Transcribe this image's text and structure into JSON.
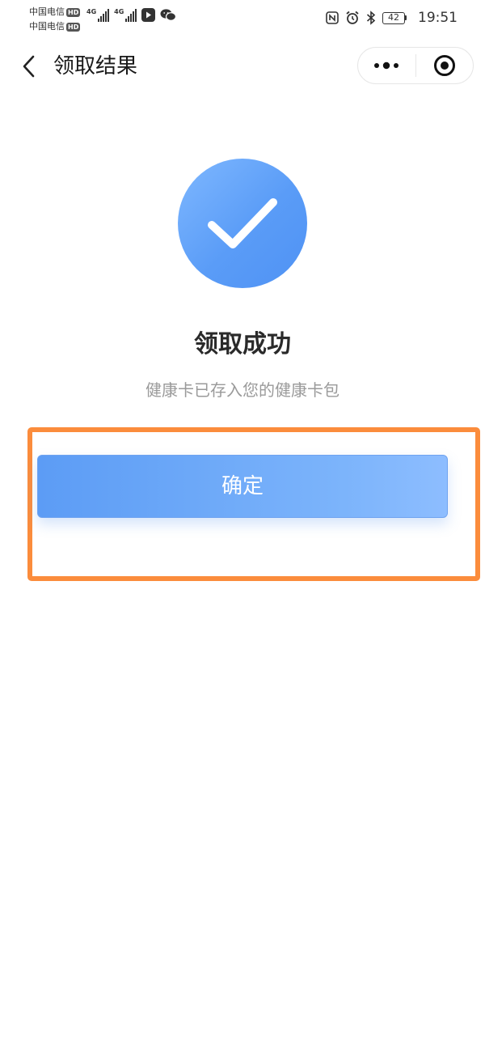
{
  "status_bar": {
    "carriers": [
      {
        "name": "中国电信",
        "badge": "HD"
      },
      {
        "name": "中国电信",
        "badge": "HD"
      }
    ],
    "network": [
      "4G",
      "4G"
    ],
    "battery_level": "42",
    "time": "19:51",
    "icons": [
      "nfc-icon",
      "alarm-icon",
      "bluetooth-icon",
      "battery-icon"
    ]
  },
  "nav": {
    "back_icon": "chevron-left-icon",
    "title": "领取结果",
    "menu_icon": "more-dots-icon",
    "close_icon": "target-close-icon"
  },
  "result": {
    "icon": "checkmark-icon",
    "title": "领取成功",
    "subtitle": "健康卡已存入您的健康卡包"
  },
  "actions": {
    "confirm_label": "确定"
  },
  "colors": {
    "accent": "#5c9cf5",
    "highlight": "#fb8c3c",
    "subtitle": "#9a9a9a",
    "title": "#2a2a2a"
  }
}
